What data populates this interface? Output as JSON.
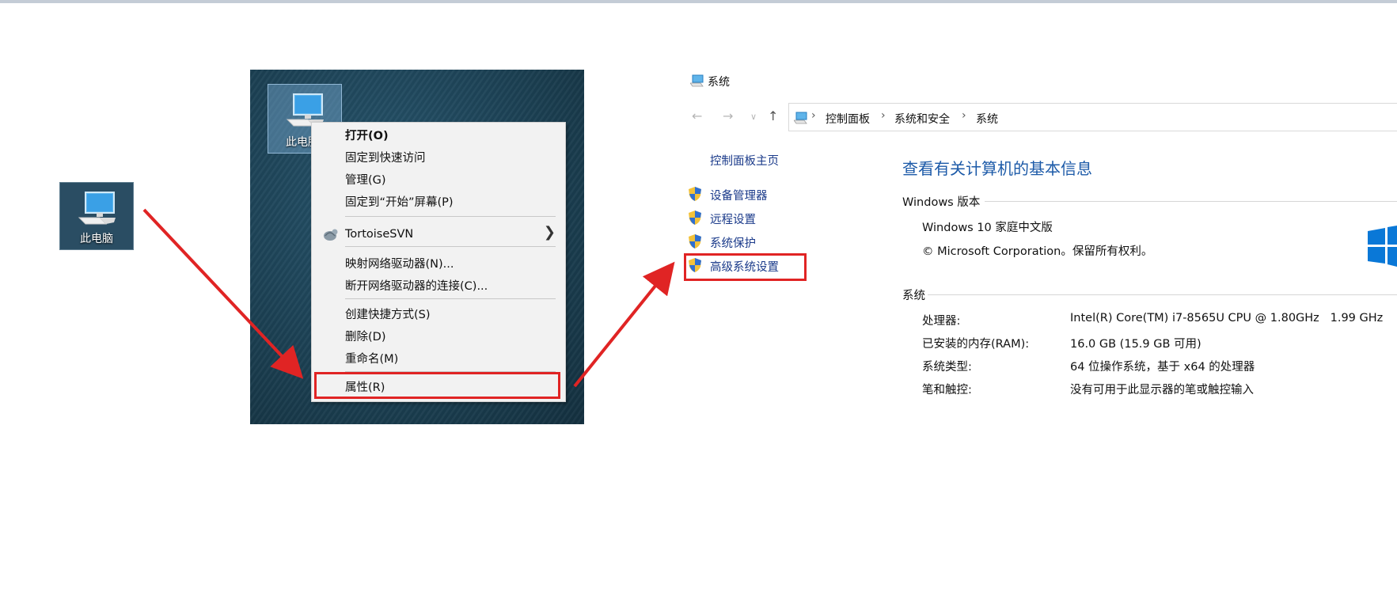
{
  "desktop_icon": {
    "label": "此电脑"
  },
  "desktop_selected_icon": {
    "label": "此电脑"
  },
  "context_menu": {
    "items": [
      {
        "label": "打开(O)"
      },
      {
        "label": "固定到快速访问"
      },
      {
        "label": "管理(G)"
      },
      {
        "label": "固定到“开始”屏幕(P)"
      },
      {
        "label": "TortoiseSVN"
      },
      {
        "label": "映射网络驱动器(N)..."
      },
      {
        "label": "断开网络驱动器的连接(C)..."
      },
      {
        "label": "创建快捷方式(S)"
      },
      {
        "label": "删除(D)"
      },
      {
        "label": "重命名(M)"
      },
      {
        "label": "属性(R)"
      }
    ]
  },
  "window": {
    "title": "系统",
    "breadcrumb": [
      "控制面板",
      "系统和安全",
      "系统"
    ]
  },
  "left_panel": {
    "home": "控制面板主页",
    "links": [
      "设备管理器",
      "远程设置",
      "系统保护",
      "高级系统设置"
    ]
  },
  "main": {
    "title": "查看有关计算机的基本信息",
    "windows_edition_header": "Windows 版本",
    "edition": "Windows 10 家庭中文版",
    "copyright": "© Microsoft Corporation。保留所有权利。",
    "system_header": "系统",
    "rows": [
      {
        "label": "处理器:",
        "value": "Intel(R) Core(TM) i7-8565U CPU @ 1.80GHz   1.99 GHz"
      },
      {
        "label": "已安装的内存(RAM):",
        "value": "16.0 GB (15.9 GB 可用)"
      },
      {
        "label": "系统类型:",
        "value": "64 位操作系统，基于 x64 的处理器"
      },
      {
        "label": "笔和触控:",
        "value": "没有可用于此显示器的笔或触控输入"
      }
    ]
  },
  "colors": {
    "highlight": "#e02424",
    "link": "#1a3a8a",
    "title_blue": "#1c5aa8",
    "windows_logo": "#0a78d7"
  }
}
